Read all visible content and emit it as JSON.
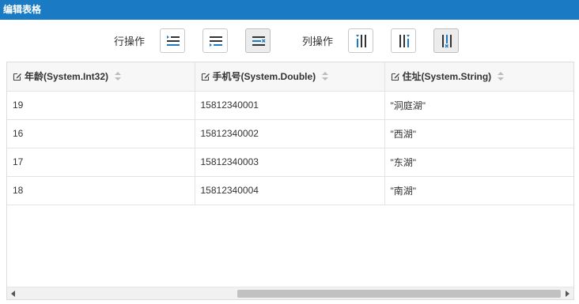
{
  "window": {
    "title": "编辑表格"
  },
  "toolbar": {
    "row_ops_label": "行操作",
    "col_ops_label": "列操作",
    "row_buttons": [
      {
        "icon": "insert-row-above-icon"
      },
      {
        "icon": "insert-row-below-icon"
      },
      {
        "icon": "delete-row-icon"
      }
    ],
    "col_buttons": [
      {
        "icon": "insert-column-left-icon"
      },
      {
        "icon": "insert-column-right-icon"
      },
      {
        "icon": "delete-column-icon"
      }
    ]
  },
  "table": {
    "columns": [
      {
        "label": "年龄(System.Int32)"
      },
      {
        "label": "手机号(System.Double)"
      },
      {
        "label": "住址(System.String)"
      }
    ],
    "rows": [
      [
        "19",
        "15812340001",
        "\"洞庭湖\""
      ],
      [
        "16",
        "15812340002",
        "\"西湖\""
      ],
      [
        "17",
        "15812340003",
        "\"东湖\""
      ],
      [
        "18",
        "15812340004",
        "\"南湖\""
      ]
    ]
  },
  "colors": {
    "titlebar": "#1a7bc4",
    "icon_blue": "#1a7bc4",
    "icon_dark": "#333333"
  }
}
